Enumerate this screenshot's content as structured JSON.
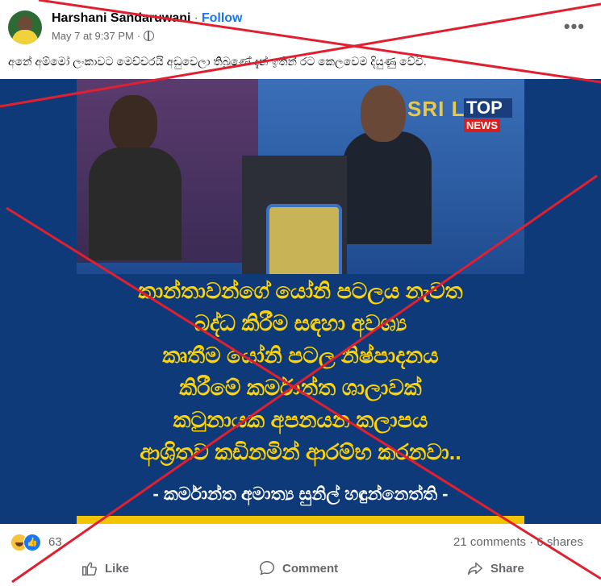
{
  "post": {
    "author": "Harshani Sandaruwani",
    "follow_label": "Follow",
    "timestamp": "May 7 at 9:37 PM",
    "separator": "·",
    "more_label": "•••",
    "caption": "අනේ අම්මෝ ලංකාවට මෙච්චරයි අඩුවෙලා තිබුණේ දැන් ඉතින් රට කෙලවෙම දියුණු වේවි."
  },
  "image": {
    "sign_text": "SRI LA",
    "badge_top": "TOP",
    "badge_news": "NEWS",
    "headline_lines": [
      "කාන්තාවන්ගේ යෝනි පටලය නැවත",
      "බද්ධ කිරීම සඳහා අවශ්‍ය",
      "කෘතීම යෝනි පටල නිෂ්පාදනය",
      "කිරීමේ කර්මාන්ත ශාලාවක්",
      "කටුනායක අපනයන කලාපය",
      "ආශ්‍රිතව කඩිනමින් ආරම්භ කරනවා.."
    ],
    "attribution": "- කර්මාන්ත අමාත්‍ය සුනිල් හඳුන්නෙත්ති -"
  },
  "stats": {
    "reaction_count": "63",
    "comments_shares": "21 comments · 6 shares"
  },
  "actions": {
    "like_label": "Like",
    "comment_label": "Comment",
    "share_label": "Share"
  },
  "colors": {
    "cross_red": "#e02030",
    "headline_yellow": "#ffd400",
    "image_blue": "#0e3a7a",
    "follow_blue": "#1877f2"
  }
}
